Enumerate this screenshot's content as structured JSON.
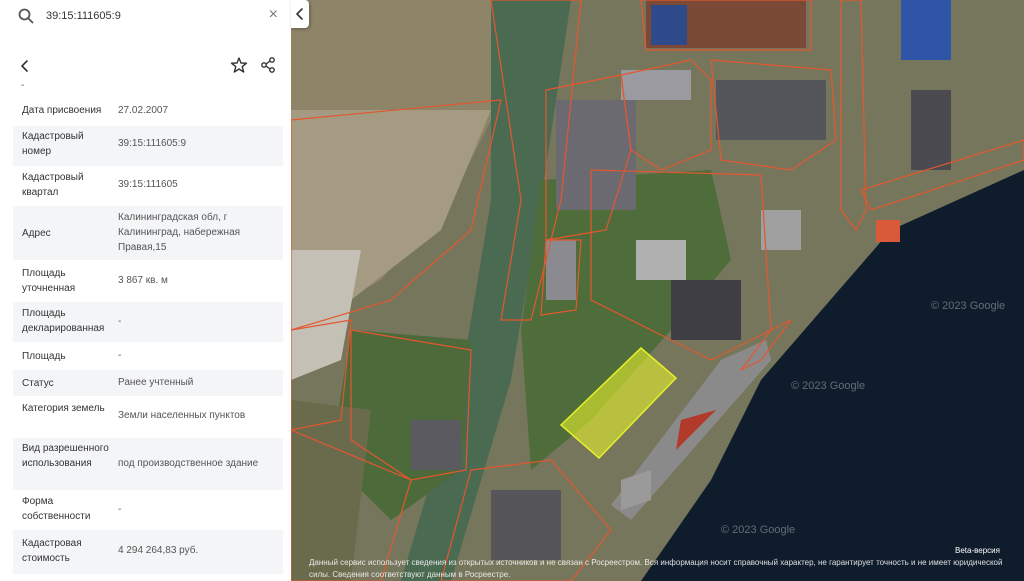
{
  "search": {
    "value": "39:15:111605:9"
  },
  "details": {
    "top_dash": "-",
    "rows": [
      {
        "label": "Дата присвоения",
        "value": "27.02.2007"
      },
      {
        "label": "Кадастровый номер",
        "value": "39:15:111605:9"
      },
      {
        "label": "Кадастровый квартал",
        "value": "39:15:111605"
      },
      {
        "label": "Адрес",
        "value": "Калининградская обл, г Калининград, набережная Правая,15"
      },
      {
        "label": "Площадь уточненная",
        "value": "3 867 кв. м"
      },
      {
        "label": "Площадь декларированная",
        "value": "-"
      },
      {
        "label": "Площадь",
        "value": "-"
      },
      {
        "label": "Статус",
        "value": "Ранее учтенный"
      },
      {
        "label": "Категория земель",
        "value": "Земли населенных пунктов"
      },
      {
        "label": "Вид разрешенного использования",
        "value": "под производственное здание"
      },
      {
        "label": "Форма собственности",
        "value": "-"
      },
      {
        "label": "Кадастровая стоимость",
        "value": "4 294 264,83 руб."
      }
    ]
  },
  "map": {
    "watermark": "© 2023 Google",
    "beta": "Beta-версия",
    "disclaimer": "Данный сервис использует сведения из открытых источников и не связан с Росреестром. Вся информация носит справочный характер, не гарантирует точность и не имеет юридической силы. Сведения соответствуют данным в Росреестре.",
    "colors": {
      "parcel_outline": "#e4572e",
      "selected_fill": "#e6f02a",
      "water": "#0d1a2a"
    }
  },
  "icons": {
    "search": "search-icon",
    "clear": "close-icon",
    "back": "chevron-left-icon",
    "favorite": "star-icon",
    "share": "share-icon",
    "collapse": "chevron-left-icon"
  }
}
